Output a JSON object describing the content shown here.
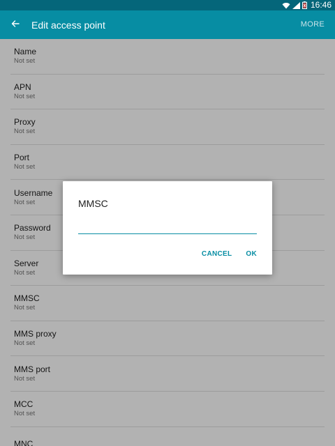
{
  "status_bar": {
    "time": "16:46",
    "icons": [
      "wifi-icon",
      "signal-icon",
      "battery-low-icon"
    ]
  },
  "app_bar": {
    "title": "Edit access point",
    "more_label": "MORE",
    "back_icon": "arrow-left-icon"
  },
  "settings": [
    {
      "label": "Name",
      "value": "Not set"
    },
    {
      "label": "APN",
      "value": "Not set"
    },
    {
      "label": "Proxy",
      "value": "Not set"
    },
    {
      "label": "Port",
      "value": "Not set"
    },
    {
      "label": "Username",
      "value": "Not set"
    },
    {
      "label": "Password",
      "value": "Not set"
    },
    {
      "label": "Server",
      "value": "Not set"
    },
    {
      "label": "MMSC",
      "value": "Not set"
    },
    {
      "label": "MMS proxy",
      "value": "Not set"
    },
    {
      "label": "MMS port",
      "value": "Not set"
    },
    {
      "label": "MCC",
      "value": "Not set"
    },
    {
      "label": "MNC",
      "value": ""
    }
  ],
  "dialog": {
    "title": "MMSC",
    "input_value": "",
    "cancel_label": "CANCEL",
    "ok_label": "OK"
  },
  "colors": {
    "status_bar": "#05667a",
    "app_bar": "#078da3",
    "accent": "#078da3",
    "battery_warning": "#e53935"
  }
}
